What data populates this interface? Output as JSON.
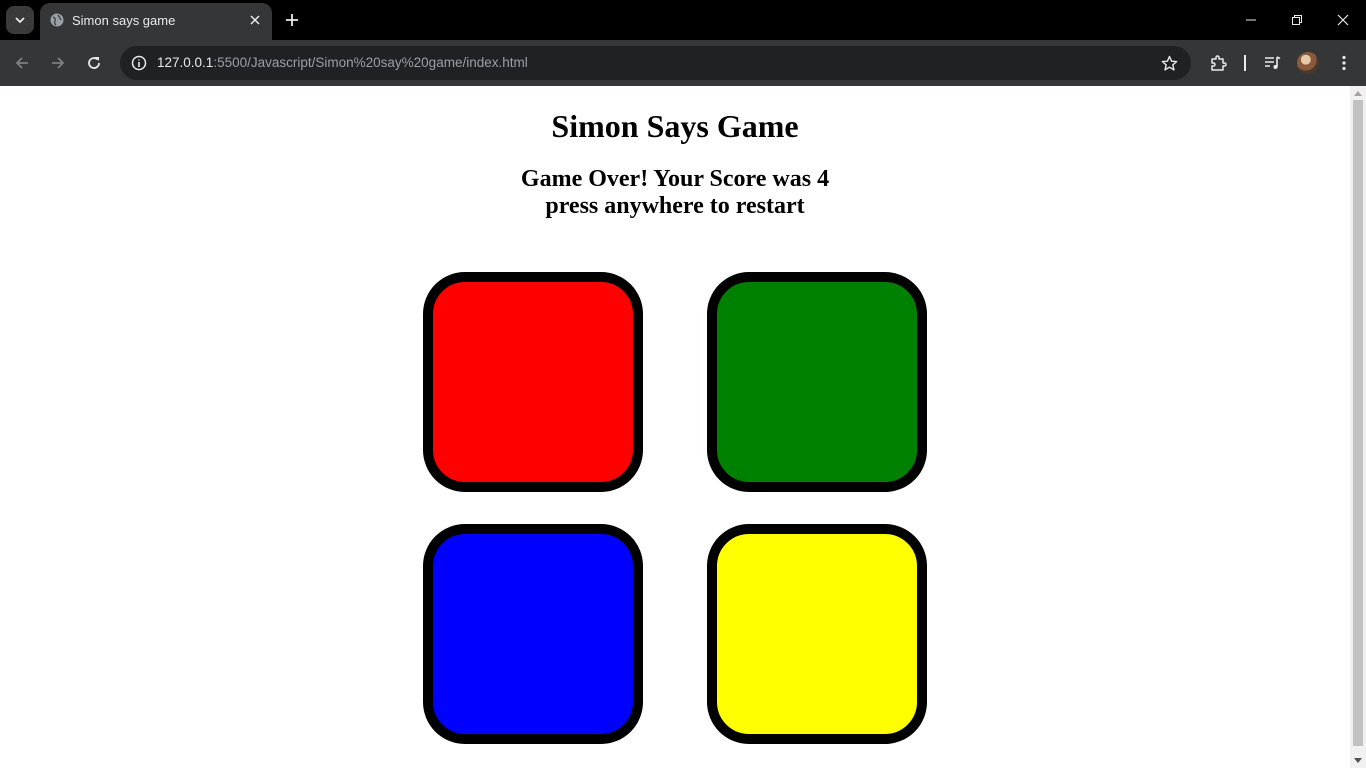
{
  "browser": {
    "tab_title": "Simon says game",
    "url_host": "127.0.0.1",
    "url_rest": ":5500/Javascript/Simon%20say%20game/index.html",
    "icons": [
      "tab-search-icon",
      "globe-icon",
      "close-icon",
      "plus-icon",
      "minimize-icon",
      "restore-icon",
      "window-close-icon",
      "back-icon",
      "forward-icon",
      "reload-icon",
      "info-icon",
      "star-icon",
      "extensions-icon",
      "media-icon",
      "avatar",
      "menu-icon"
    ]
  },
  "page": {
    "title": "Simon Says Game",
    "status_line1": "Game Over! Your Score was 4",
    "status_line2": "press anywhere to restart",
    "score": 4,
    "buttons": [
      {
        "id": "red",
        "color": "#ff0000"
      },
      {
        "id": "green",
        "color": "#008000"
      },
      {
        "id": "blue",
        "color": "#0000ff"
      },
      {
        "id": "yellow",
        "color": "#ffff00"
      }
    ]
  }
}
